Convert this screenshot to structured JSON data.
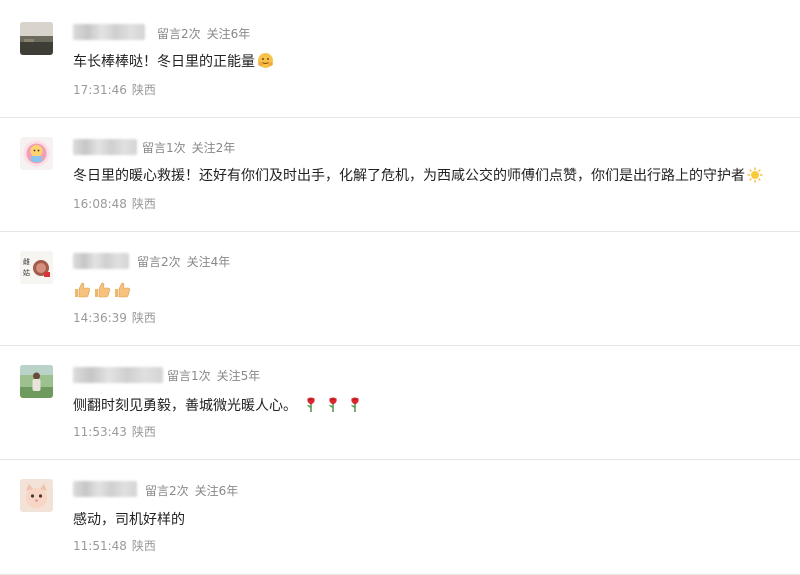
{
  "comments": [
    {
      "nickname_hidden": true,
      "message_count": "留言2次",
      "follow_years": "关注6年",
      "text": "车长棒棒哒！冬日里的正能量",
      "emoji": "hugging-face",
      "time": "17:31:46",
      "location": "陕西"
    },
    {
      "nickname_hidden": true,
      "message_count": "留言1次",
      "follow_years": "关注2年",
      "text": "冬日里的暖心救援！还好有你们及时出手，化解了危机，为西咸公交的师傅们点赞，你们是出行路上的守护者",
      "emoji": "sun",
      "time": "16:08:48",
      "location": "陕西"
    },
    {
      "nickname_hidden": true,
      "message_count": "留言2次",
      "follow_years": "关注4年",
      "text": "",
      "emoji": "thumbs-up x3",
      "time": "14:36:39",
      "location": "陕西"
    },
    {
      "nickname_hidden": true,
      "message_count": "留言1次",
      "follow_years": "关注5年",
      "text": "侧翻时刻见勇毅，善城微光暖人心。",
      "emoji": "rose x3",
      "time": "11:53:43",
      "location": "陕西"
    },
    {
      "nickname_hidden": true,
      "message_count": "留言2次",
      "follow_years": "关注6年",
      "text": "感动，司机好样的",
      "emoji": "",
      "time": "11:51:48",
      "location": "陕西"
    }
  ]
}
